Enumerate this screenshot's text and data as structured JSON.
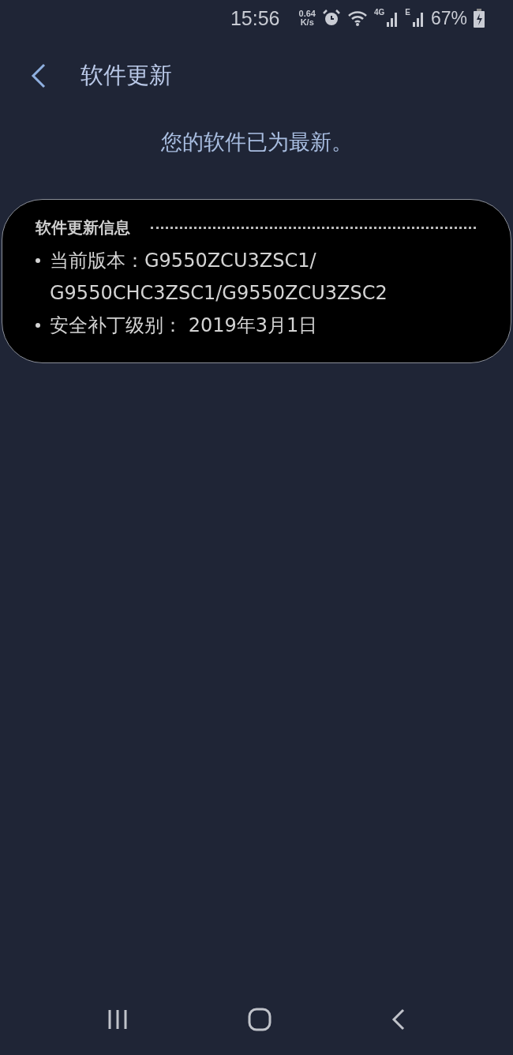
{
  "status_bar": {
    "time": "15:56",
    "speed_value": "0.64",
    "speed_unit": "K/s",
    "network_1": "4G",
    "network_2": "E",
    "battery": "67%"
  },
  "header": {
    "title": "软件更新"
  },
  "message": "您的软件已为最新。",
  "info_card": {
    "title": "软件更新信息",
    "items": [
      {
        "lines": [
          "当前版本：G9550ZCU3ZSC1/",
          "G9550CHC3ZSC1/G9550ZCU3ZSC2"
        ]
      },
      {
        "lines": [
          "安全补丁级别： 2019年3月1日"
        ]
      }
    ]
  }
}
